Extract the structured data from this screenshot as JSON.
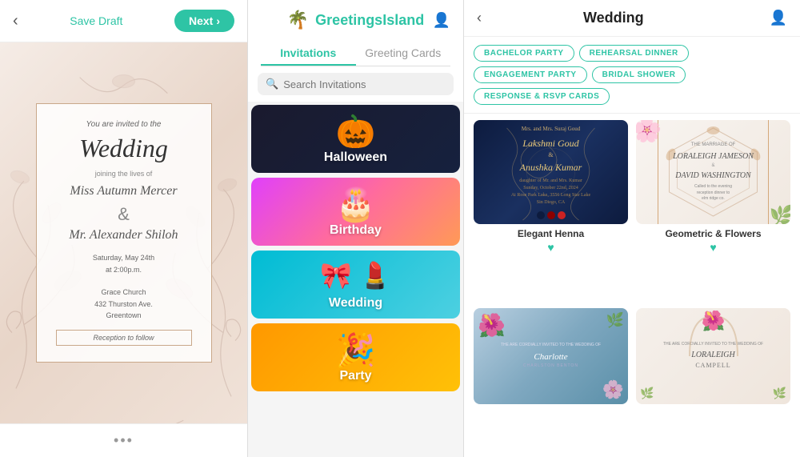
{
  "leftPanel": {
    "backIcon": "‹",
    "saveDraftLabel": "Save Draft",
    "nextLabel": "Next",
    "nextIcon": "›",
    "card": {
      "invitedText": "You are invited to the",
      "title": "Wedding",
      "joiningText": "joining the lives of",
      "name1": "Miss Autumn Mercer",
      "ampersand": "&",
      "name2": "Mr. Alexander Shiloh",
      "date": "Saturday, May 24th",
      "time": "at 2:00p.m.",
      "venue": "Grace Church",
      "address1": "432 Thurston Ave.",
      "city": "Greentown",
      "reception": "Reception to follow"
    },
    "dotsLabel": "•••"
  },
  "middlePanel": {
    "brandIcon": "🌴",
    "brandName": "GreetingsIsland",
    "profileIcon": "👤",
    "tabs": [
      {
        "label": "Invitations",
        "active": true
      },
      {
        "label": "Greeting Cards",
        "active": false
      }
    ],
    "search": {
      "placeholder": "Search Invitations"
    },
    "categories": [
      {
        "label": "Halloween",
        "emoji": "🎃",
        "colorClass": "cat-halloween"
      },
      {
        "label": "Birthday",
        "emoji": "🎂",
        "colorClass": "cat-birthday"
      },
      {
        "label": "Wedding",
        "emoji": "🎀💄",
        "colorClass": "cat-wedding"
      },
      {
        "label": "Party",
        "emoji": "🎉",
        "colorClass": "cat-party"
      }
    ]
  },
  "rightPanel": {
    "backIcon": "‹",
    "title": "Wedding",
    "profileIcon": "👤",
    "filterTags": [
      "BACHELOR PARTY",
      "REHEARSAL DINNER",
      "ENGAGEMENT PARTY",
      "BRIDAL SHOWER",
      "RESPONSE & RSVP CARDS"
    ],
    "cards": [
      {
        "name": "Elegant Henna",
        "heartIcon": "♥",
        "colorDots": [
          "#0d1b3e",
          "#8b0000",
          "#cc0000"
        ],
        "type": "elegant-henna"
      },
      {
        "name": "Geometric & Flowers",
        "heartIcon": "♥",
        "colorDots": [],
        "type": "geometric"
      },
      {
        "name": "",
        "heartIcon": "",
        "colorDots": [],
        "type": "blue-floral"
      },
      {
        "name": "",
        "heartIcon": "",
        "colorDots": [],
        "type": "arch"
      }
    ]
  }
}
